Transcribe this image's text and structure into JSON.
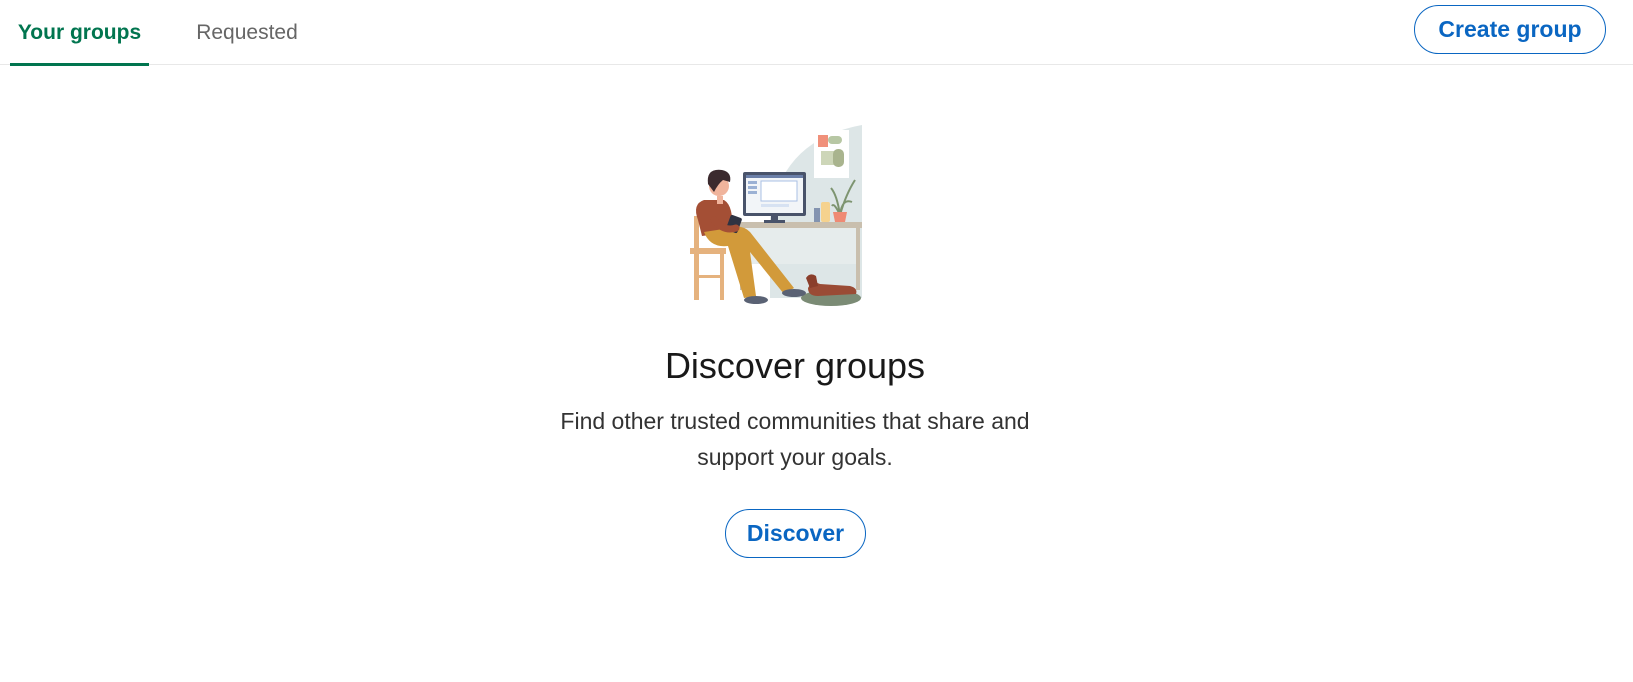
{
  "tabs": [
    {
      "label": "Your groups",
      "active": true
    },
    {
      "label": "Requested",
      "active": false
    }
  ],
  "header": {
    "create_label": "Create group"
  },
  "empty_state": {
    "illustration": "person-at-desk-illustration",
    "title": "Discover groups",
    "description": "Find other trusted communities that share and support your goals.",
    "button_label": "Discover"
  },
  "colors": {
    "accent_green": "#01754f",
    "link_blue": "#0a66c2",
    "inactive_tab": "#666666",
    "divider": "#e8e8e8"
  }
}
